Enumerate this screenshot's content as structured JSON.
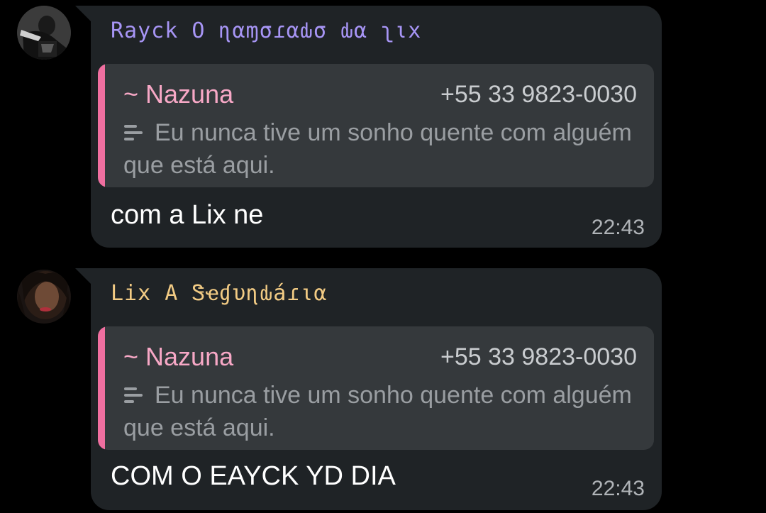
{
  "messages": [
    {
      "sender": "Rayck O ɳαɱσɾαԃσ ԃα ʅιx",
      "quote": {
        "author": "~ Nazuna",
        "phone": "+55 33 9823-0030",
        "text": "Eu nunca tive um sonho quente com alguém que está aqui."
      },
      "text": "com a Lix ne",
      "time": "22:43"
    },
    {
      "sender": "Lix A Ꮥҽɠυɳԃáɾια",
      "quote": {
        "author": "~ Nazuna",
        "phone": "+55 33 9823-0030",
        "text": "Eu nunca tive um sonho quente com alguém que está aqui."
      },
      "text": "COM O EAYCK YD DIA",
      "time": "22:43"
    }
  ],
  "colors": {
    "background": "#000000",
    "bubble": "#1f2326",
    "quote_bg": "#35393c",
    "quote_bar": "#f06fa0",
    "sender_1": "#a795f5",
    "sender_2": "#f2cb84",
    "quote_author": "#f7a8c6"
  },
  "icons": {
    "quote_type": "text-lines-icon"
  }
}
